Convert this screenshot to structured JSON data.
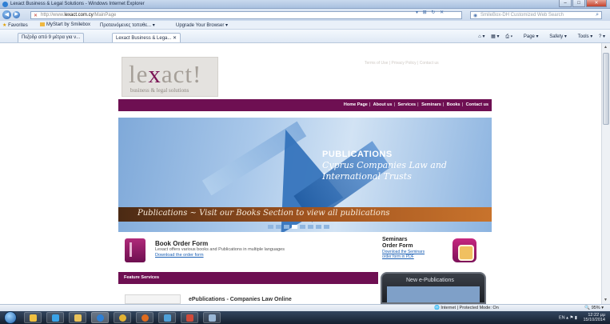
{
  "window": {
    "title": "Lexact Business & Legal Solutions - Windows Internet Explorer"
  },
  "address": {
    "url_prefix": "http://www.",
    "url_domain": "lexact.com.cy",
    "url_suffix": "/MainPage"
  },
  "search": {
    "placeholder": "SmileBox-DH Customized Web Search"
  },
  "favorites": {
    "label": "Favorites",
    "items": [
      "MyStart by Smilebox",
      "Προτεινόμενες τοποθε...",
      "Upgrade Your Browser"
    ]
  },
  "tabs": [
    {
      "label": "Πεζοδρ από 9 μέτρα για ν..."
    },
    {
      "label": "Lexact Business & Lega..."
    }
  ],
  "commandbar": {
    "page": "Page",
    "safety": "Safety",
    "tools": "Tools"
  },
  "site": {
    "logo_text_left": "le",
    "logo_text_x": "x",
    "logo_text_right": "act!",
    "logo_sub": "business & legal solutions",
    "top_links": "Terms of Use | Privacy Policy | Contact us",
    "nav": [
      "Home Page",
      "About us",
      "Services",
      "Seminars",
      "Books",
      "Contact us"
    ],
    "banner": {
      "title": "PUBLICATIONS",
      "subtitle_line1": "Cyprus Companies Law and",
      "subtitle_line2": "International Trusts",
      "strip_text": "Publications ~ Visit our Books Section to view all publications",
      "active_slide": 4,
      "slide_count": 8
    },
    "order": {
      "title": "Book Order Form",
      "desc": "Lexact offers various books and Publications in multiple languages",
      "link": "Download the order form"
    },
    "seminars": {
      "title1": "Seminars",
      "title2": "Order Form",
      "link1": "Download the Seminars",
      "link2": "order form in PDF"
    },
    "feature": {
      "title": "Feature Services",
      "item": "ePublications - Companies Law Online"
    },
    "epub": {
      "title": "New e-Publications"
    }
  },
  "status": {
    "zone": "Internet | Protected Mode: On",
    "zoom": "95%"
  },
  "tray": {
    "lang": "EN",
    "time": "12:22 μμ",
    "date": "15/10/2014"
  },
  "colors": {
    "brand": "#6e0f52",
    "link": "#1a5fb4"
  }
}
